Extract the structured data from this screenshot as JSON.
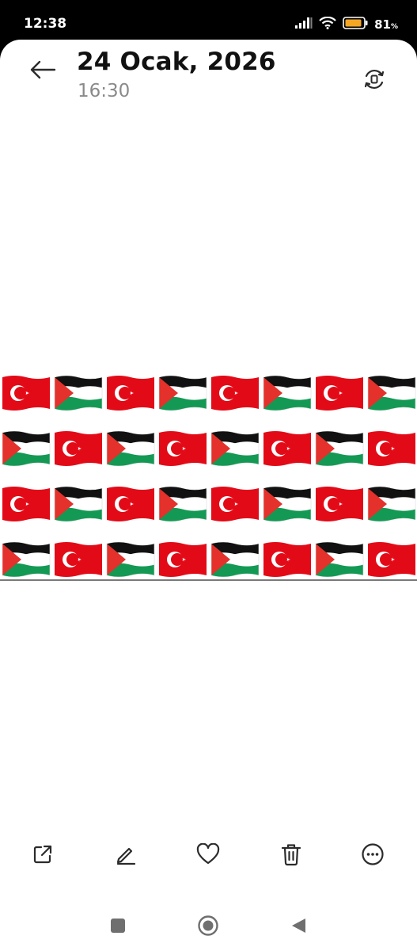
{
  "status_bar": {
    "time": "12:38",
    "battery_percent": "81",
    "battery_unit": "%",
    "icons": [
      "signal-icon",
      "wifi-icon",
      "battery-icon"
    ]
  },
  "header": {
    "date": "24 Ocak, 2026",
    "time": "16:30",
    "icons": [
      "back-arrow-icon",
      "rotate-screen-icon"
    ]
  },
  "photo": {
    "description_icons": [
      "turkey-flag-icon",
      "palestine-flag-icon"
    ],
    "rows": [
      [
        "turkey",
        "palestine",
        "turkey",
        "palestine",
        "turkey",
        "palestine",
        "turkey",
        "palestine"
      ],
      [
        "palestine",
        "turkey",
        "palestine",
        "turkey",
        "palestine",
        "turkey",
        "palestine",
        "turkey"
      ],
      [
        "turkey",
        "palestine",
        "turkey",
        "palestine",
        "turkey",
        "palestine",
        "turkey",
        "palestine"
      ],
      [
        "palestine",
        "turkey",
        "palestine",
        "turkey",
        "palestine",
        "turkey",
        "palestine",
        "turkey"
      ]
    ]
  },
  "toolbar": {
    "icons": [
      "share-icon",
      "edit-icon",
      "favorite-icon",
      "delete-icon",
      "more-icon"
    ]
  },
  "navbar": {
    "icons": [
      "recents-icon",
      "home-icon",
      "back-icon"
    ]
  },
  "colors": {
    "turkey_red": "#e30a17",
    "palestine_green": "#149954",
    "palestine_red": "#e4312b",
    "icon_dark": "#2b2b2b",
    "battery_fill": "#f5a623"
  }
}
